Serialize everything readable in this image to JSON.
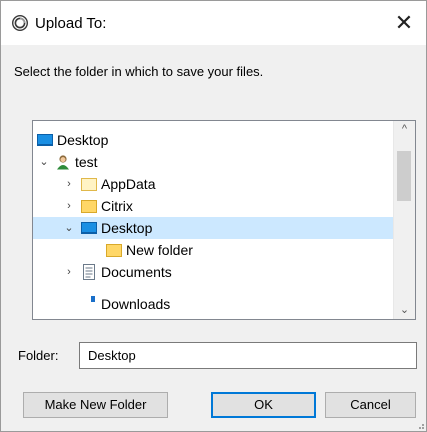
{
  "window": {
    "title": "Upload To:",
    "close_glyph": "✕"
  },
  "instruction": "Select the folder in which to save your files.",
  "tree": {
    "items": [
      {
        "label": "Desktop",
        "icon": "desktop-icon",
        "chevron": ""
      },
      {
        "label": "test",
        "icon": "user-icon",
        "chevron": "⌄"
      },
      {
        "label": "AppData",
        "icon": "folder-icon",
        "chevron": "›"
      },
      {
        "label": "Citrix",
        "icon": "folder-icon",
        "chevron": "›"
      },
      {
        "label": "Desktop",
        "icon": "desktop-icon",
        "chevron": "⌄",
        "selected": true
      },
      {
        "label": "New folder",
        "icon": "folder-icon",
        "chevron": ""
      },
      {
        "label": "Documents",
        "icon": "documents-icon",
        "chevron": "›"
      },
      {
        "label": "Downloads",
        "icon": "downloads-icon",
        "chevron": ""
      }
    ],
    "scroll_up_glyph": "^",
    "scroll_down_glyph": "⌄"
  },
  "folder": {
    "label": "Folder:",
    "value": "Desktop"
  },
  "buttons": {
    "make_new_folder": "Make New Folder",
    "ok": "OK",
    "cancel": "Cancel"
  },
  "colors": {
    "selection": "#cce8ff",
    "folder": "#ffd767",
    "desktop": "#1a8fe3",
    "default_button_border": "#0078d7"
  }
}
